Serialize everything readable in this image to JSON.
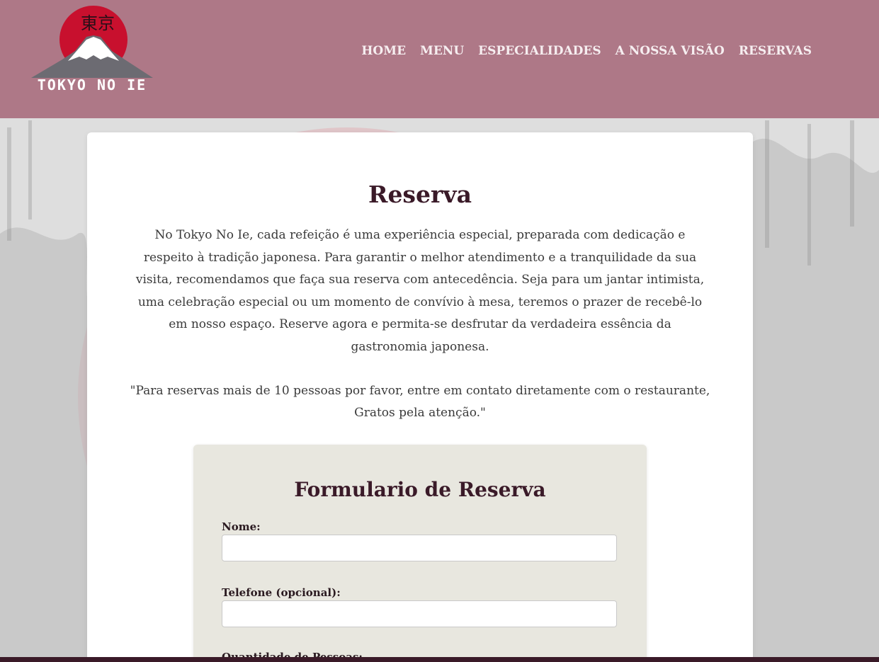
{
  "logo": {
    "kanji": "東京",
    "text": "TOKYO NO IE"
  },
  "nav": {
    "items": [
      {
        "label": "HOME"
      },
      {
        "label": "MENU"
      },
      {
        "label": "ESPECIALIDADES"
      },
      {
        "label": "A NOSSA VISÃO"
      },
      {
        "label": "RESERVAS"
      }
    ]
  },
  "main": {
    "title": "Reserva",
    "intro": "No Tokyo No Ie, cada refeição é uma experiência especial, preparada com dedicação e respeito à tradição japonesa. Para garantir o melhor atendimento e a tranquilidade da sua visita, recomendamos que faça sua reserva com antecedência. Seja para um jantar intimista, uma celebração especial ou um momento de convívio à mesa, teremos o prazer de recebê-lo em nosso espaço. Reserve agora e permita-se desfrutar da verdadeira essência da gastronomia japonesa.",
    "notice": "\"Para reservas mais de 10 pessoas por favor, entre em contato diretamente com o restaurante, Gratos pela atenção.\""
  },
  "form": {
    "title": "Formulario de Reserva",
    "fields": [
      {
        "label": "Nome:",
        "value": ""
      },
      {
        "label": "Telefone (opcional):",
        "value": ""
      },
      {
        "label": "Quantidade de Pessoas:",
        "value": ""
      }
    ]
  },
  "colors": {
    "header": "#a46274",
    "accent_red": "#c8102e",
    "title_text": "#3a1a28",
    "form_bg": "#e8e7df"
  }
}
